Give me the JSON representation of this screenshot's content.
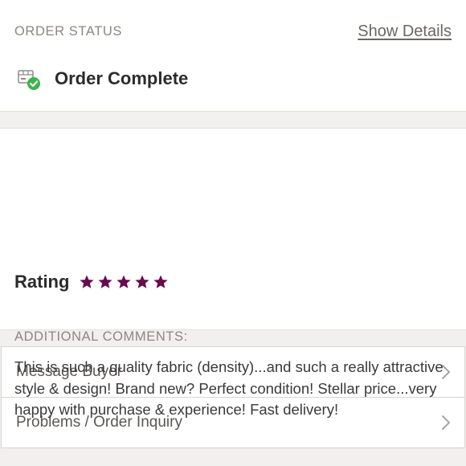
{
  "order_status": {
    "label": "ORDER STATUS",
    "show_details": "Show Details",
    "status_text": "Order Complete"
  },
  "review": {
    "rating_label": "Rating",
    "rating_value": 5,
    "rating_max": 5,
    "star_color": "#6a0a4f",
    "comments_label": "ADDITIONAL COMMENTS:",
    "comment_text": "This is such a quality fabric (density)...and such a really attractive style & design! Brand new? Perfect condition! Stellar price...very happy with purchase & experience! Fast delivery!"
  },
  "menu": {
    "items": [
      {
        "label": "Message Buyer",
        "icon": "chevron-right-icon"
      },
      {
        "label": "Problems / Order Inquiry",
        "icon": "chevron-right-icon"
      }
    ]
  },
  "colors": {
    "success_green": "#3ab54a",
    "background": "#f2f0ef"
  }
}
